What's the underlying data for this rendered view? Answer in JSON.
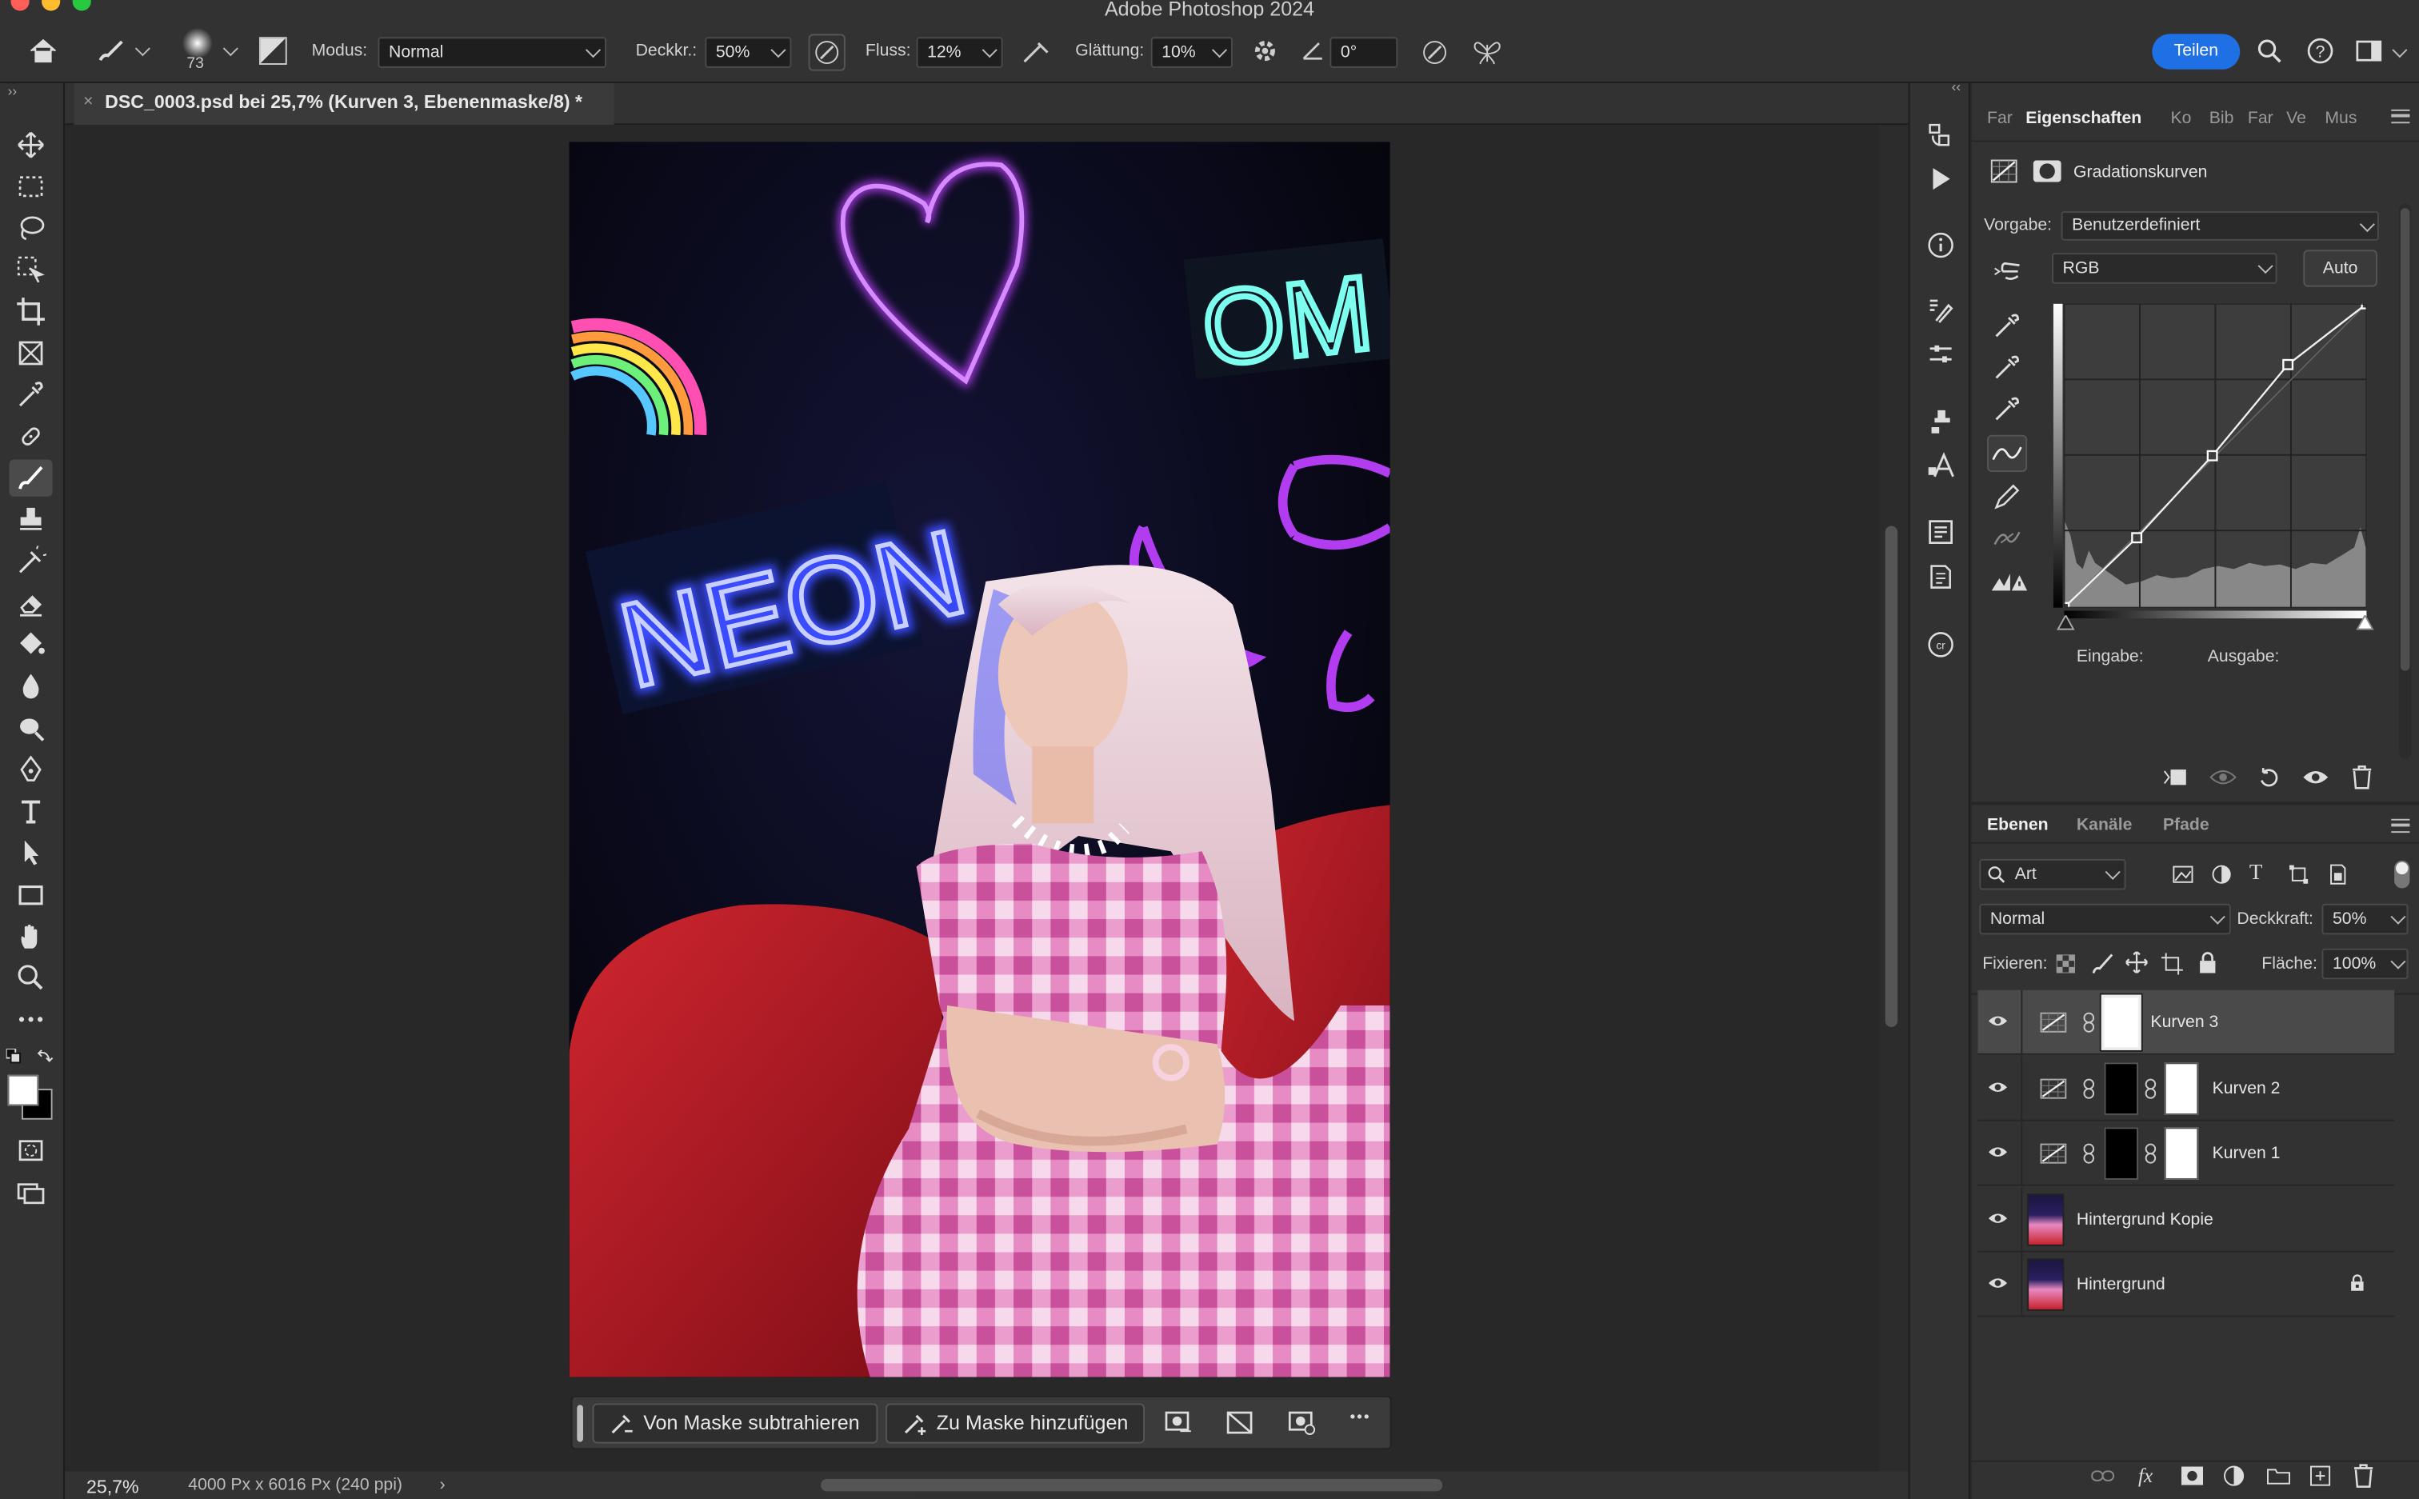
{
  "app": {
    "title": "Adobe Photoshop 2024"
  },
  "options": {
    "brush_size": "73",
    "mode_label": "Modus:",
    "mode_value": "Normal",
    "opacity_label": "Deckkr.:",
    "opacity_value": "50%",
    "flow_label": "Fluss:",
    "flow_value": "12%",
    "smoothing_label": "Glättung:",
    "smoothing_value": "10%",
    "angle_value": "0°",
    "share_label": "Teilen"
  },
  "document": {
    "tab_title": "DSC_0003.psd bei 25,7% (Kurven 3, Ebenenmaske/8) *"
  },
  "status": {
    "zoom": "25,7%",
    "dimensions": "4000 Px x 6016 Px (240 ppi)",
    "arrow": "›"
  },
  "mask_bar": {
    "subtract_label": "Von Maske subtrahieren",
    "add_label": "Zu Maske hinzufügen",
    "more_label": "•••"
  },
  "properties": {
    "tabs": [
      "Far",
      "Eigenschaften",
      "Ko",
      "Bib",
      "Far",
      "Ve",
      "Mus"
    ],
    "active_tab": "Eigenschaften",
    "adjustment_title": "Gradationskurven",
    "preset_label": "Vorgabe:",
    "preset_value": "Benutzerdefiniert",
    "channel_value": "RGB",
    "auto_label": "Auto",
    "input_label": "Eingabe:",
    "output_label": "Ausgabe:",
    "curve_points": [
      [
        0,
        0
      ],
      [
        0.24,
        0.23
      ],
      [
        0.49,
        0.5
      ],
      [
        0.74,
        0.8
      ],
      [
        1,
        1
      ]
    ]
  },
  "layers_panel": {
    "tabs": [
      "Ebenen",
      "Kanäle",
      "Pfade"
    ],
    "active_tab": "Ebenen",
    "filter_value": "Art",
    "blend_mode": "Normal",
    "opacity_label": "Deckkraft:",
    "opacity_value": "50%",
    "lock_label": "Fixieren:",
    "fill_label": "Fläche:",
    "fill_value": "100%",
    "layers": [
      {
        "name": "Kurven 3",
        "type": "adjustment",
        "selected": true,
        "locked": false
      },
      {
        "name": "Kurven 2",
        "type": "adjustment",
        "selected": false,
        "locked": false
      },
      {
        "name": "Kurven 1",
        "type": "adjustment",
        "selected": false,
        "locked": false
      },
      {
        "name": "Hintergrund Kopie",
        "type": "image",
        "selected": false,
        "locked": false
      },
      {
        "name": "Hintergrund",
        "type": "image",
        "selected": false,
        "locked": true
      }
    ]
  },
  "canvas": {
    "neon_sign_text": "NEON",
    "neon_partial_text": "OM"
  },
  "colors": {
    "accent": "#1f6fe5",
    "panel": "#323232",
    "background": "#282828",
    "neon_blue": "#3b4bff",
    "neon_purple": "#b23cf0",
    "sofa_red": "#c8232d",
    "dress_pink": "#e889c2"
  }
}
